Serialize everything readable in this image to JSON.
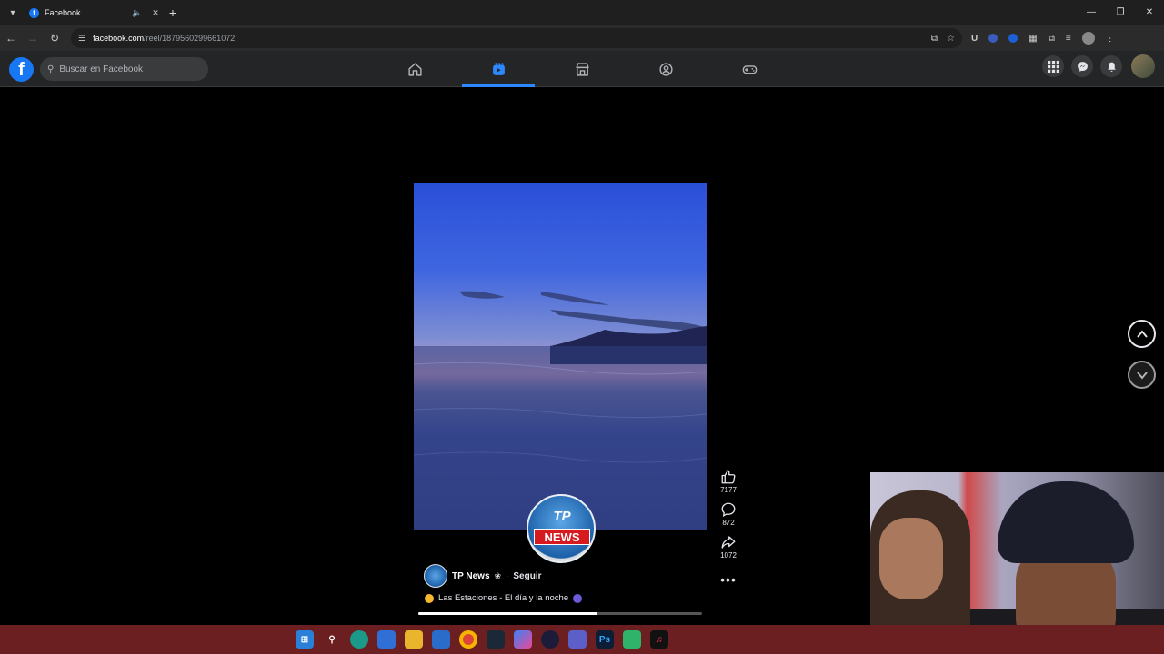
{
  "browser": {
    "tab_title": "Facebook",
    "url_host": "facebook.com",
    "url_path": "/reel/1879560299661072"
  },
  "facebook": {
    "search_placeholder": "Buscar en Facebook",
    "nav": [
      "home-icon",
      "reels-icon",
      "marketplace-icon",
      "groups-icon",
      "gaming-icon"
    ],
    "active_nav": "reels-icon",
    "accent": "#1877f2"
  },
  "reel": {
    "logo_top": "TP",
    "logo_bottom": "NEWS",
    "author": "TP News",
    "follow_label": "Seguir",
    "separator": "·",
    "caption": "Las Estaciones - El día y la noche",
    "progress": 0.63,
    "likes": "7177",
    "comments": "872",
    "shares": "1072"
  }
}
